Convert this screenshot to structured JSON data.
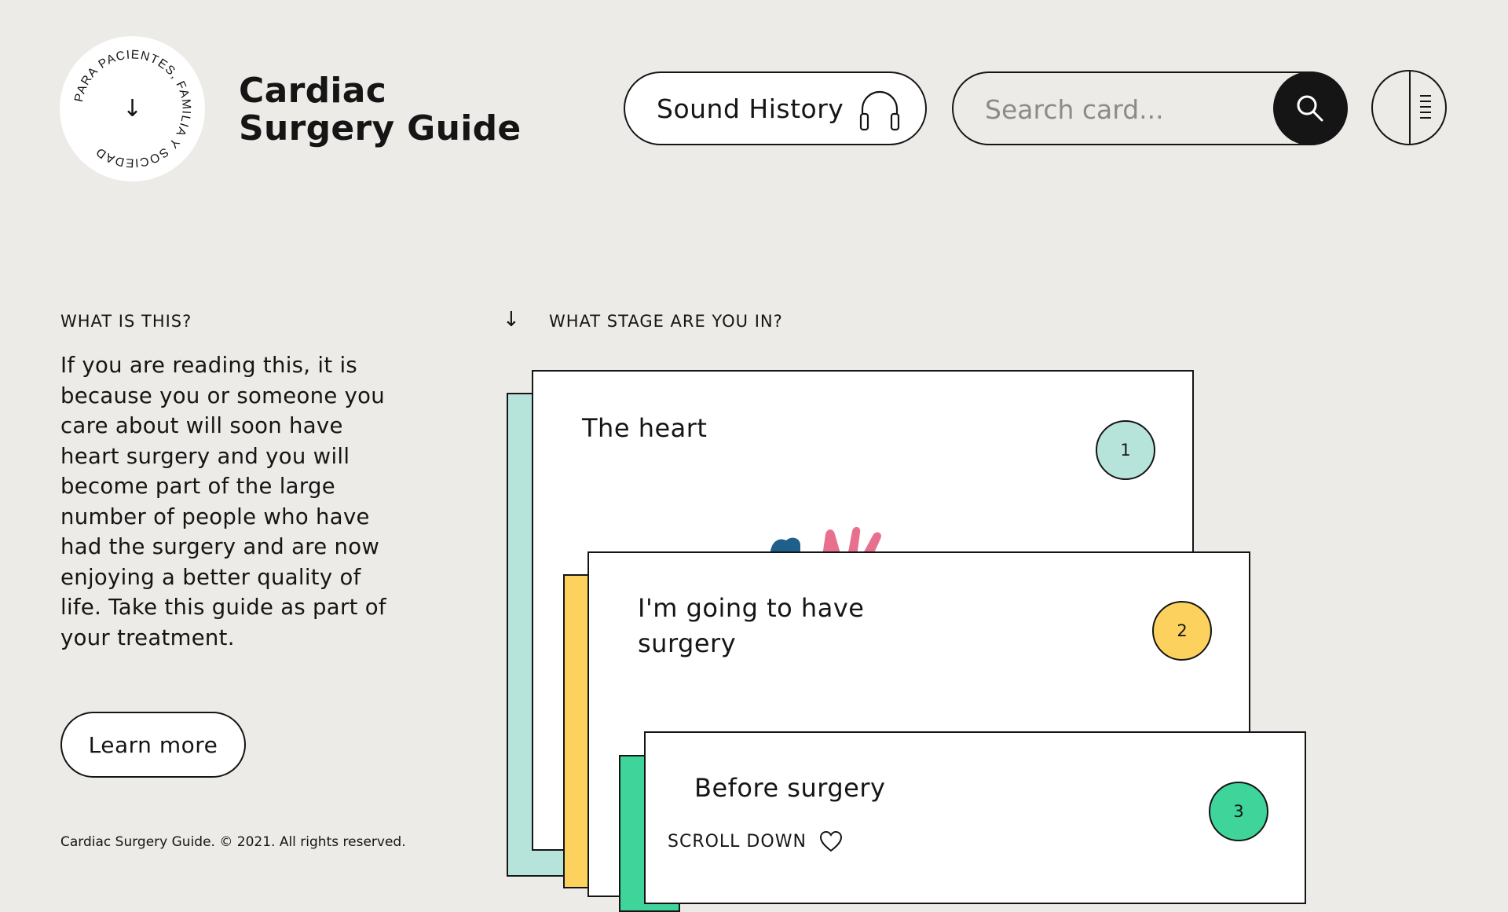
{
  "header": {
    "badge_text": "PARA PACIENTES, FAMILIA Y SOCIEDAD",
    "badge_arrow": "↓",
    "title_line1": "Cardiac",
    "title_line2": "Surgery Guide",
    "sound_history_label": "Sound History",
    "search_placeholder": "Search card..."
  },
  "left": {
    "section_label": "WHAT IS THIS?",
    "intro_text": "If you are reading this, it is because you or someone you care about will soon have heart surgery and you will become part of the large number of people who have had the surgery and are now enjoying a better quality of life. Take this guide as part of your treatment.",
    "learn_more_label": "Learn more",
    "footer_text": "Cardiac Surgery Guide. © 2021. All rights reserved."
  },
  "stages": {
    "arrow": "↓",
    "section_label": "WHAT STAGE ARE YOU IN?",
    "scroll_down_label": "SCROLL DOWN",
    "cards": [
      {
        "title": "The heart",
        "number": "1",
        "color": "#b7e4da"
      },
      {
        "title": "I'm going to have\nsurgery",
        "number": "2",
        "color": "#fdd15d"
      },
      {
        "title": "Before surgery",
        "number": "3",
        "color": "#3ed49a"
      }
    ]
  },
  "colors": {
    "background": "#edebe7",
    "ink": "#151515",
    "heart_blue": "#1e5f8c",
    "heart_pink": "#e8708e"
  }
}
